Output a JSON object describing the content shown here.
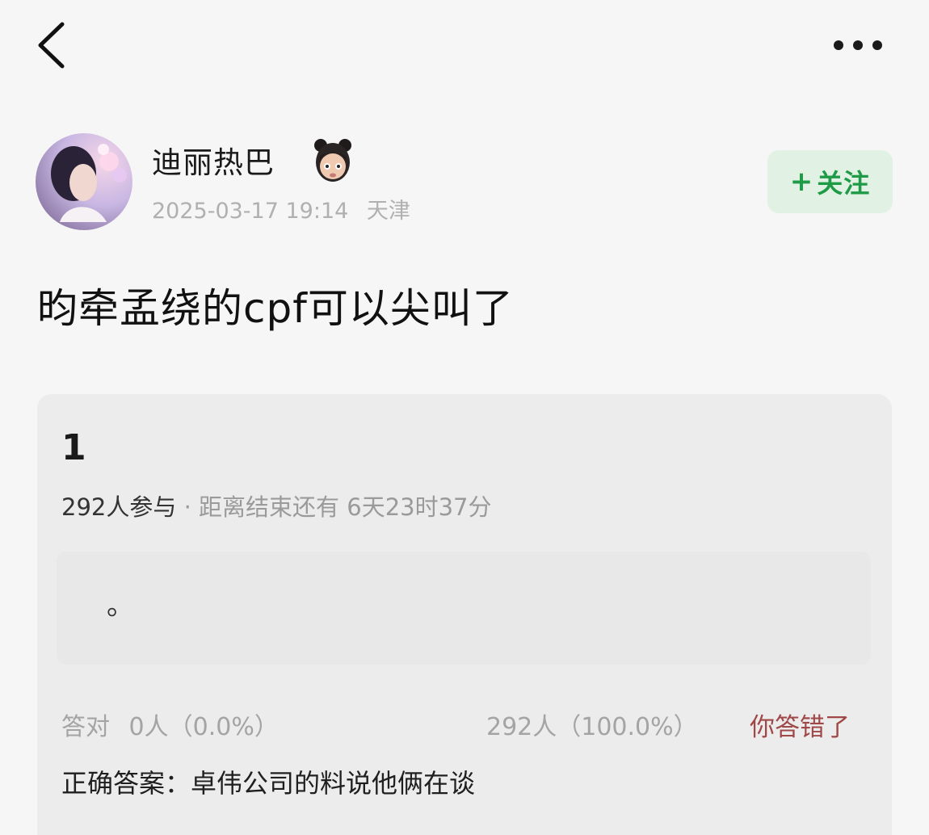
{
  "header": {
    "back_icon": "chevron-left-icon",
    "more_icon": "more-horizontal-icon"
  },
  "author": {
    "name": "迪丽热巴",
    "avatar_icon": "avatar",
    "badge_icon": "cartoon-girl-emoji-icon",
    "timestamp": "2025-03-17 19:14",
    "location": "天津"
  },
  "follow_button": {
    "plus": "+",
    "label": "关注",
    "color": "#1f9b47",
    "background": "#e1f1e4"
  },
  "post": {
    "title": "昀牵孟绕的cpf可以尖叫了"
  },
  "quiz": {
    "number": "1",
    "participants": "292人参与",
    "separator": " · ",
    "time_left_label": "距离结束还有",
    "time_left": "6天23时37分",
    "option_text": "。",
    "correct_label": "答对",
    "correct_stats": "0人（0.0%）",
    "wrong_stats": "292人（100.0%）",
    "wrong_label": "你答错了",
    "wrong_color": "#a04848",
    "answer_line": "正确答案：卓伟公司的料说他俩在谈"
  }
}
